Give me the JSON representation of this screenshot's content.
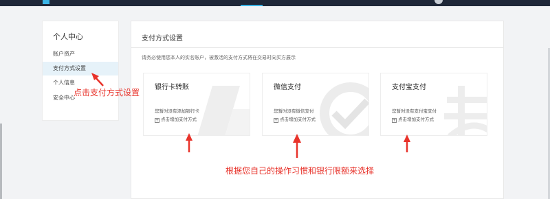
{
  "colors": {
    "topbar": "#1f2738",
    "accent": "#3ab4e6",
    "active_bg": "#e6f2f9",
    "annotation": "#e8332b"
  },
  "sidebar": {
    "title": "个人中心",
    "items": [
      {
        "label": "账户资产",
        "active": false
      },
      {
        "label": "支付方式设置",
        "active": true
      },
      {
        "label": "个人信息",
        "active": false
      },
      {
        "label": "安全中心",
        "active": false
      }
    ]
  },
  "main": {
    "title": "支付方式设置",
    "notice": "请务必使用您本人的实名账户，被激活的支付方式将在交易时向买方展示",
    "cards": [
      {
        "title": "银行卡转账",
        "empty_text": "您暂时没有添加银行卡",
        "add_label": "点击增加支付方式",
        "watermark_icon": "bank-card-watermark-icon"
      },
      {
        "title": "微信支付",
        "empty_text": "您暂时没有微信支付",
        "add_label": "点击增加支付方式",
        "watermark_icon": "wechat-check-watermark-icon"
      },
      {
        "title": "支付宝支付",
        "empty_text": "您暂时没有支付宝支付",
        "add_label": "点击增加支付方式",
        "watermark_icon": "alipay-watermark-icon"
      }
    ]
  },
  "annotations": {
    "sidebar_hint": "点击支付方式设置",
    "cards_hint": "根据您自己的操作习惯和银行限额来选择"
  }
}
